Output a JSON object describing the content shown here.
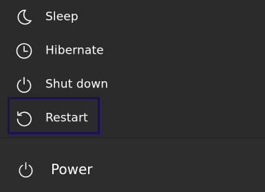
{
  "power_menu": {
    "items": [
      {
        "label": "Sleep",
        "icon": "moon-icon"
      },
      {
        "label": "Hibernate",
        "icon": "clock-icon"
      },
      {
        "label": "Shut down",
        "icon": "power-icon"
      },
      {
        "label": "Restart",
        "icon": "restart-icon"
      }
    ],
    "highlighted_item": "Restart",
    "highlight_color": "#1e0f5c"
  },
  "power_button": {
    "label": "Power",
    "icon": "power-icon"
  },
  "colors": {
    "background": "#2b2b2b",
    "text": "#ffffff"
  }
}
